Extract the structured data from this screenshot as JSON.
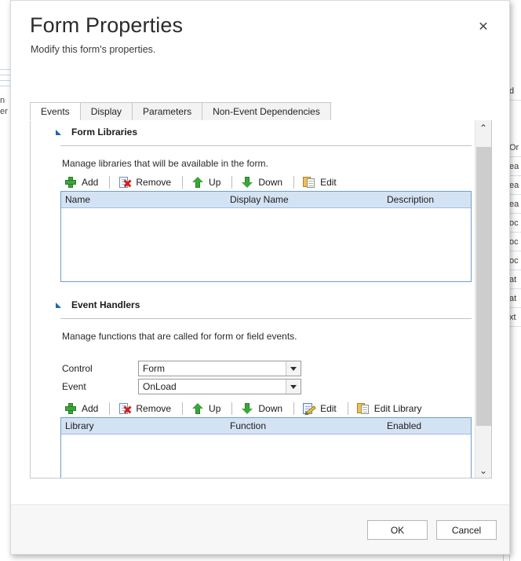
{
  "dialog": {
    "title": "Form Properties",
    "subtitle": "Modify this form's properties.",
    "close_label": "✕"
  },
  "tabs": [
    {
      "label": "Events",
      "active": true
    },
    {
      "label": "Display",
      "active": false
    },
    {
      "label": "Parameters",
      "active": false
    },
    {
      "label": "Non-Event Dependencies",
      "active": false
    }
  ],
  "sections": {
    "form_libraries": {
      "title": "Form Libraries",
      "description": "Manage libraries that will be available in the form.",
      "toolbar": [
        {
          "label": "Add",
          "icon": "plus-icon"
        },
        {
          "label": "Remove",
          "icon": "remove-document-icon"
        },
        {
          "label": "Up",
          "icon": "arrow-up-icon"
        },
        {
          "label": "Down",
          "icon": "arrow-down-icon"
        },
        {
          "label": "Edit",
          "icon": "edit-documents-icon"
        }
      ],
      "grid": {
        "columns": [
          "Name",
          "Display Name",
          "Description"
        ],
        "rows": []
      }
    },
    "event_handlers": {
      "title": "Event Handlers",
      "description": "Manage functions that are called for form or field events.",
      "fields": [
        {
          "label": "Control",
          "value": "Form"
        },
        {
          "label": "Event",
          "value": "OnLoad"
        }
      ],
      "toolbar": [
        {
          "label": "Add",
          "icon": "plus-icon"
        },
        {
          "label": "Remove",
          "icon": "remove-document-icon"
        },
        {
          "label": "Up",
          "icon": "arrow-up-icon"
        },
        {
          "label": "Down",
          "icon": "arrow-down-icon"
        },
        {
          "label": "Edit",
          "icon": "edit-pencil-icon"
        },
        {
          "label": "Edit Library",
          "icon": "edit-documents-icon"
        }
      ],
      "grid": {
        "columns": [
          "Library",
          "Function",
          "Enabled"
        ],
        "rows": []
      }
    }
  },
  "footer": {
    "ok_label": "OK",
    "cancel_label": "Cancel"
  },
  "scrollbar": {
    "up_label": "⌃",
    "down_label": "⌄"
  },
  "colors": {
    "accent": "#1568b8",
    "grid_border": "#6f9fd0",
    "selected_header": "#d4e3f3"
  }
}
